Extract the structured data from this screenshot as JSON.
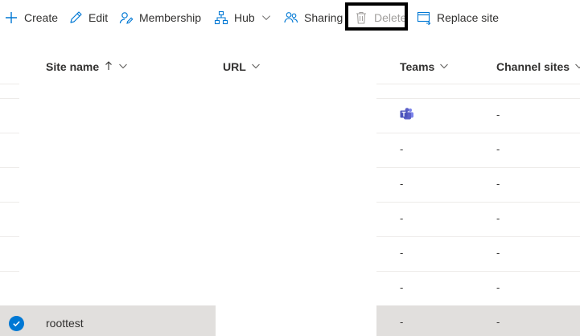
{
  "toolbar": {
    "create": "Create",
    "edit": "Edit",
    "membership": "Membership",
    "hub": "Hub",
    "sharing": "Sharing",
    "delete": "Delete",
    "replace_site": "Replace site"
  },
  "columns": {
    "site_name": "Site name",
    "url": "URL",
    "teams": "Teams",
    "channel_sites": "Channel sites"
  },
  "rows": [
    {
      "teams_icon": "microsoft-teams-icon",
      "channel_sites": "-"
    },
    {
      "teams": "-",
      "channel_sites": "-"
    },
    {
      "teams": "-",
      "channel_sites": "-"
    },
    {
      "teams": "-",
      "channel_sites": "-"
    },
    {
      "teams": "-",
      "channel_sites": "-"
    },
    {
      "teams": "-",
      "channel_sites": "-"
    },
    {
      "site_name": "roottest",
      "teams": "-",
      "channel_sites": "-",
      "selected": true
    }
  ],
  "colors": {
    "accent": "#0078d4",
    "selected_row": "#e1dfdd",
    "teams": "#5b5fc7"
  }
}
